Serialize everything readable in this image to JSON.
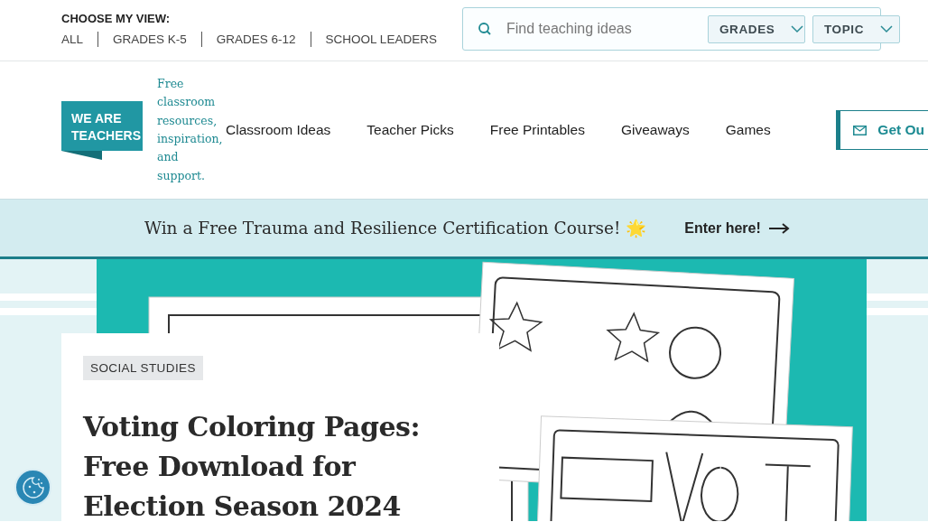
{
  "view_chooser": {
    "label": "CHOOSE MY VIEW:",
    "options": [
      "ALL",
      "GRADES K-5",
      "GRADES 6-12",
      "SCHOOL LEADERS"
    ]
  },
  "search": {
    "placeholder": "Find teaching ideas",
    "filters": [
      "GRADES",
      "TOPIC"
    ]
  },
  "logo": {
    "lines": [
      "WE ARE",
      "TEACHERS"
    ],
    "tagline": "Free classroom resources, inspiration, and support."
  },
  "nav": {
    "items": [
      "Classroom Ideas",
      "Teacher Picks",
      "Free Printables",
      "Giveaways",
      "Games"
    ],
    "cta": "Get Ou"
  },
  "banner": {
    "text": "Win a Free Trauma and Resilience Certification Course! 🌟",
    "link": "Enter here!"
  },
  "article": {
    "category": "SOCIAL STUDIES",
    "title": "Voting Coloring Pages: Free Download for Election Season 2024"
  }
}
